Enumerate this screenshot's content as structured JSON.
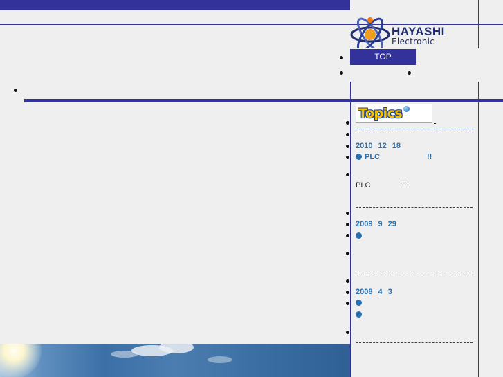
{
  "logo": {
    "line1": "HAYASHI",
    "line2": "Electronic"
  },
  "nav": {
    "top_label": "TOP"
  },
  "topics": {
    "badge": "Topics",
    "items": [
      {
        "date": [
          "2010",
          "12",
          "18"
        ],
        "headline": "PLC",
        "headline_suffix": "!!",
        "body": "PLC",
        "body_suffix": "!!"
      },
      {
        "date": [
          "2009",
          "9",
          "29"
        ]
      },
      {
        "date": [
          "2008",
          "4",
          "3"
        ]
      }
    ]
  },
  "colors": {
    "accent": "#33329a",
    "link": "#2a6fb0"
  }
}
